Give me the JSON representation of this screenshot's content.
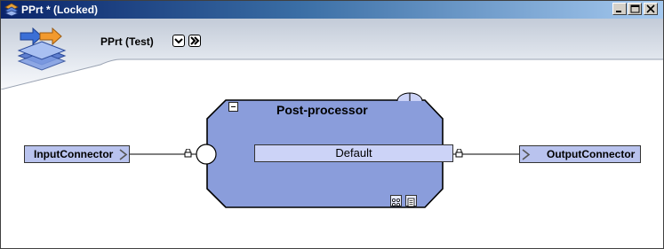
{
  "window": {
    "title": "PPrt * (Locked)",
    "controls": [
      "minimize",
      "maximize",
      "close"
    ]
  },
  "header": {
    "title": "PPrt (Test)",
    "logo_icon": "layers-arrows-icon",
    "buttons": [
      "dropdown-icon",
      "fast-forward-icon"
    ]
  },
  "diagram": {
    "input_connector": {
      "label": "InputConnector",
      "icon": "chevron-right-icon"
    },
    "output_connector": {
      "label": "OutputConnector",
      "icon": "chevron-right-icon"
    },
    "processor": {
      "title": "Post-processor",
      "output_port_label": "Default",
      "fill_color": "#8a9ddb",
      "tools": [
        "expand-icon",
        "properties-icon"
      ]
    }
  },
  "colors": {
    "titlebar_start": "#0a246a",
    "titlebar_end": "#a6caf0",
    "connector_fill": "#b9c3ee",
    "port_fill": "#ccd3f7"
  }
}
